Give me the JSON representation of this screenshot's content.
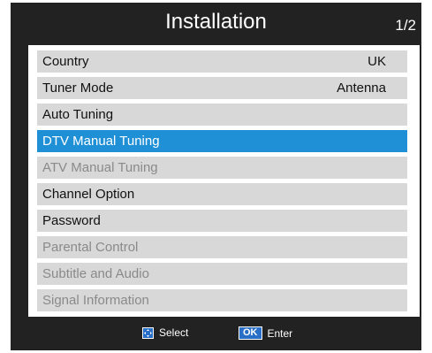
{
  "header": {
    "title": "Installation",
    "page": "1/2"
  },
  "menu": {
    "items": [
      {
        "label": "Country",
        "value": "UK",
        "state": "enabled"
      },
      {
        "label": "Tuner Mode",
        "value": "Antenna",
        "state": "enabled"
      },
      {
        "label": "Auto Tuning",
        "value": "",
        "state": "enabled"
      },
      {
        "label": "DTV Manual Tuning",
        "value": "",
        "state": "selected"
      },
      {
        "label": "ATV Manual Tuning",
        "value": "",
        "state": "disabled"
      },
      {
        "label": "Channel Option",
        "value": "",
        "state": "enabled"
      },
      {
        "label": "Password",
        "value": "",
        "state": "enabled"
      },
      {
        "label": "Parental Control",
        "value": "",
        "state": "disabled"
      },
      {
        "label": "Subtitle and Audio",
        "value": "",
        "state": "disabled"
      },
      {
        "label": "Signal Information",
        "value": "",
        "state": "disabled"
      }
    ]
  },
  "footer": {
    "select_icon": "dpad-icon",
    "select_label": "Select",
    "ok_badge": "OK",
    "enter_label": "Enter"
  },
  "colors": {
    "highlight": "#1f8fd6",
    "background": "#222222",
    "row": "#d8d8d8",
    "disabled_text": "#8a8a8a"
  }
}
